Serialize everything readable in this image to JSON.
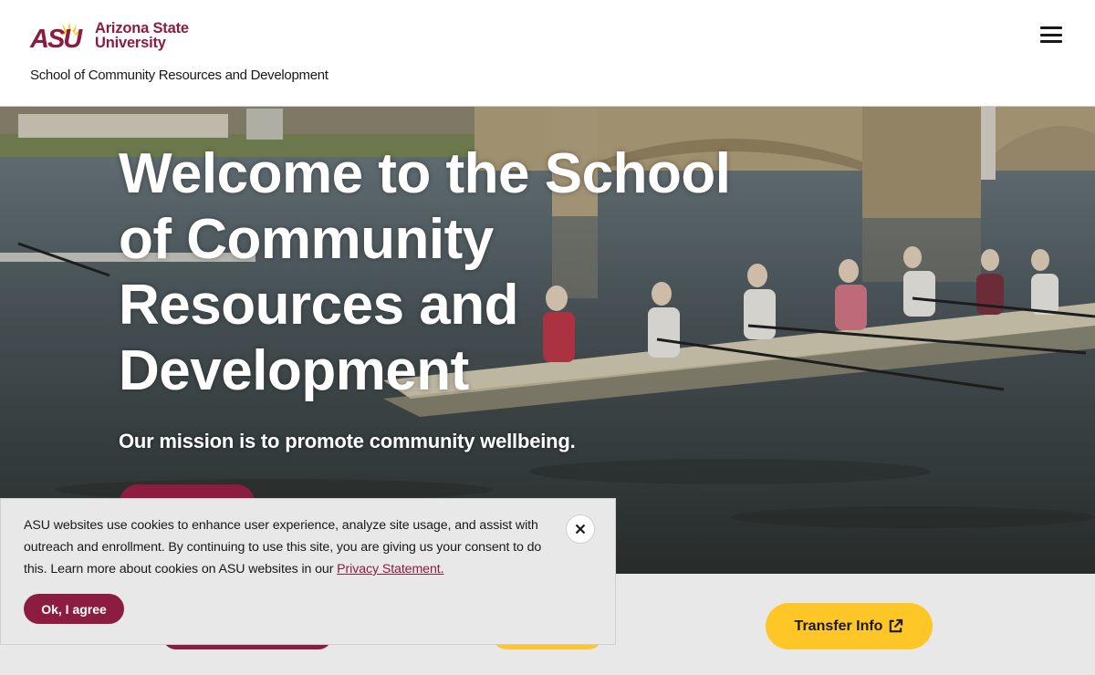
{
  "header": {
    "logo": {
      "acronym": "ASU",
      "line1": "Arizona State",
      "line2": "University"
    },
    "unit_name": "School of Community Resources and Development",
    "menu_icon": "hamburger-menu-icon"
  },
  "hero": {
    "title_lines": [
      "Welcome to the School",
      "of Community",
      "Resources and",
      "Development"
    ],
    "mission": "Our mission is to promote community wellbeing."
  },
  "actions": {
    "transfer_label": "Transfer Info",
    "transfer_icon": "external-link-icon"
  },
  "cookie_banner": {
    "text": "ASU websites use cookies to enhance user experience, analyze site usage, and assist with outreach and enrollment. By continuing to use this site, you are giving us your consent to do this. Learn more about cookies on ASU websites in our ",
    "link_label": "Privacy Statement.",
    "agree_label": "Ok, I agree",
    "close_icon": "close-icon"
  },
  "colors": {
    "maroon": "#8c1d40",
    "gold": "#ffc627",
    "banner_bg": "#e8e8e8"
  }
}
